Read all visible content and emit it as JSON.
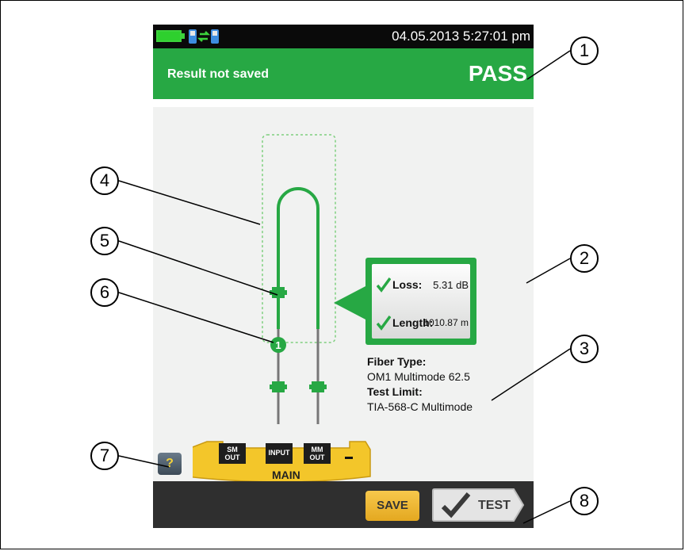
{
  "status_bar": {
    "datetime": "04.05.2013 5:27:01 pm",
    "battery_icon": "battery-full-icon",
    "link_icon": "remote-link-icon"
  },
  "header": {
    "save_status": "Result not saved",
    "result": "PASS"
  },
  "results": {
    "loss_label": "Loss:",
    "loss_value": "5.31 dB",
    "length_label": "Length:",
    "length_value": "1010.87 m"
  },
  "fiber_info": {
    "fiber_type_label": "Fiber Type:",
    "fiber_type_value": "OM1 Multimode 62.5",
    "test_limit_label": "Test Limit:",
    "test_limit_value": "TIA-568-C Multimode"
  },
  "diagram": {
    "reference_index": "1"
  },
  "main_unit": {
    "label": "MAIN",
    "ports": [
      {
        "line1": "SM",
        "line2": "OUT"
      },
      {
        "line1": "INPUT",
        "line2": ""
      },
      {
        "line1": "MM",
        "line2": "OUT"
      }
    ]
  },
  "help_label": "?",
  "toolbar": {
    "save_label": "SAVE",
    "test_label": "TEST"
  },
  "callouts": [
    "1",
    "2",
    "3",
    "4",
    "5",
    "6",
    "7",
    "8"
  ],
  "colors": {
    "pass_green": "#27a844",
    "status_black": "#0a0a0a",
    "save_yellow": "#e4a820",
    "toolbar_dark": "#2f2f2f"
  }
}
